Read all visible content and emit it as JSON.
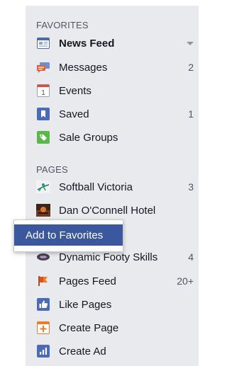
{
  "favorites": {
    "header": "FAVORITES",
    "items": [
      {
        "label": "News Feed",
        "count": "",
        "icon": "news-feed-icon"
      },
      {
        "label": "Messages",
        "count": "2",
        "icon": "messages-icon"
      },
      {
        "label": "Events",
        "count": "",
        "icon": "events-icon",
        "icon_text": "1"
      },
      {
        "label": "Saved",
        "count": "1",
        "icon": "saved-icon"
      },
      {
        "label": "Sale Groups",
        "count": "",
        "icon": "sale-groups-icon"
      }
    ]
  },
  "pages": {
    "header": "PAGES",
    "items": [
      {
        "label": "Softball Victoria",
        "count": "3",
        "icon": "softball-victoria-icon"
      },
      {
        "label": "Dan O'Connell Hotel",
        "count": "",
        "icon": "dan-oconnell-hotel-icon"
      },
      {
        "label": "Dynamic Footy Skills",
        "count": "4",
        "icon": "dynamic-footy-skills-icon"
      },
      {
        "label": "Pages Feed",
        "count": "20+",
        "icon": "pages-feed-icon"
      },
      {
        "label": "Like Pages",
        "count": "",
        "icon": "like-pages-icon"
      },
      {
        "label": "Create Page",
        "count": "",
        "icon": "create-page-icon"
      },
      {
        "label": "Create Ad",
        "count": "",
        "icon": "create-ad-icon"
      }
    ]
  },
  "popup": {
    "label": "Add to Favorites"
  },
  "colors": {
    "sidebar_bg": "#e9eaed",
    "popup_button_bg": "#3b579d",
    "text": "#141823",
    "muted": "#4e5665"
  }
}
